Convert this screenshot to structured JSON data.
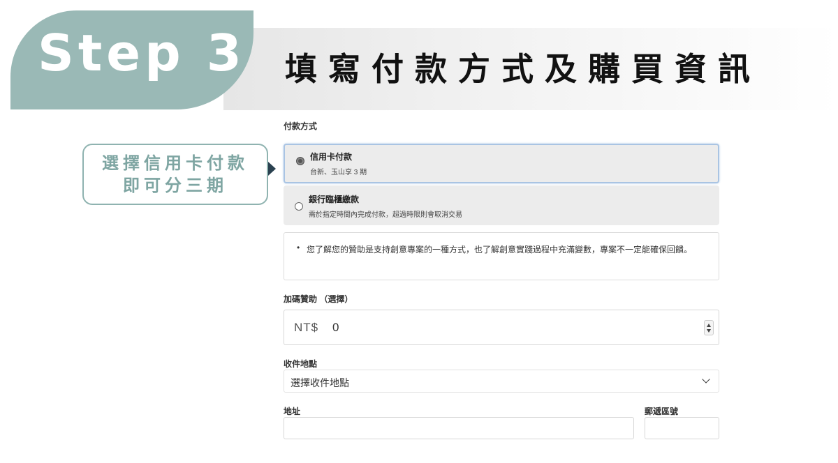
{
  "header": {
    "step": "Step 3",
    "title": "填寫付款方式及購買資訊"
  },
  "callout": {
    "line1": "選擇信用卡付款",
    "line2": "即可分三期"
  },
  "form": {
    "payment_label": "付款方式",
    "options": [
      {
        "title": "信用卡付款",
        "subtitle": "台新、玉山享 3 期",
        "selected": true
      },
      {
        "title": "銀行臨櫃繳款",
        "subtitle": "需於指定時間內完成付款，超過時限則會取消交易",
        "selected": false
      }
    ],
    "notice": "您了解您的贊助是支持創意專案的一種方式，也了解創意實踐過程中充滿變數，專案不一定能確保回饋。",
    "bonus_label": "加碼贊助 （選擇）",
    "currency": "NT$",
    "amount": "0",
    "pickup_label": "收件地點",
    "pickup_value": "選擇收件地點",
    "address_label": "地址",
    "zip_label": "郵遞區號"
  },
  "colors": {
    "badge": "#9ab9b6",
    "callout": "#7ea5a2",
    "selected_border": "#a9c4e3"
  }
}
